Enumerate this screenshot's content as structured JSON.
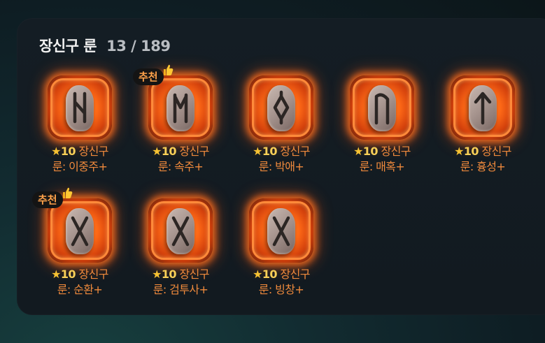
{
  "panel": {
    "title": "장신구 룬",
    "count": "13 / 189"
  },
  "runes": [
    {
      "star": "★",
      "grade": "10",
      "line1": "장신구",
      "line2": "룬: 이중주+",
      "glyph": "eihwaz",
      "recommended": false
    },
    {
      "star": "★",
      "grade": "10",
      "line1": "장신구",
      "line2": "룬: 속주+",
      "glyph": "mannaz",
      "recommended": true,
      "badge": "추천"
    },
    {
      "star": "★",
      "grade": "10",
      "line1": "장신구",
      "line2": "룬: 박애+",
      "glyph": "ingwaz",
      "recommended": false
    },
    {
      "star": "★",
      "grade": "10",
      "line1": "장신구",
      "line2": "룬: 매혹+",
      "glyph": "uruz",
      "recommended": false
    },
    {
      "star": "★",
      "grade": "10",
      "line1": "장신구",
      "line2": "룬: 흉성+",
      "glyph": "tiwaz",
      "recommended": false
    },
    {
      "star": "★",
      "grade": "10",
      "line1": "장신구",
      "line2": "룬: 순환+",
      "glyph": "gebo",
      "recommended": true,
      "badge": "추천"
    },
    {
      "star": "★",
      "grade": "10",
      "line1": "장신구",
      "line2": "룬: 검투사+",
      "glyph": "gebo",
      "recommended": false
    },
    {
      "star": "★",
      "grade": "10",
      "line1": "장신구",
      "line2": "룬: 빙창+",
      "glyph": "gebo",
      "recommended": false
    }
  ],
  "colors": {
    "label": "#f08a3c",
    "star": "#f7c233",
    "badge_text": "#ffa24a",
    "glow": "#ff6a17"
  }
}
